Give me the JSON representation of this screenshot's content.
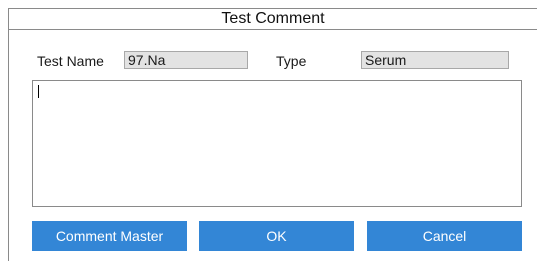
{
  "dialog": {
    "title": "Test Comment"
  },
  "fields": {
    "test_name_label": "Test Name",
    "test_name_value": "97.Na",
    "type_label": "Type",
    "type_value": "Serum"
  },
  "comment": {
    "value": ""
  },
  "buttons": {
    "comment_master": "Comment Master",
    "ok": "OK",
    "cancel": "Cancel"
  },
  "colors": {
    "button_bg": "#3386d6",
    "button_text": "#ffffff",
    "field_bg": "#e3e3e3"
  }
}
